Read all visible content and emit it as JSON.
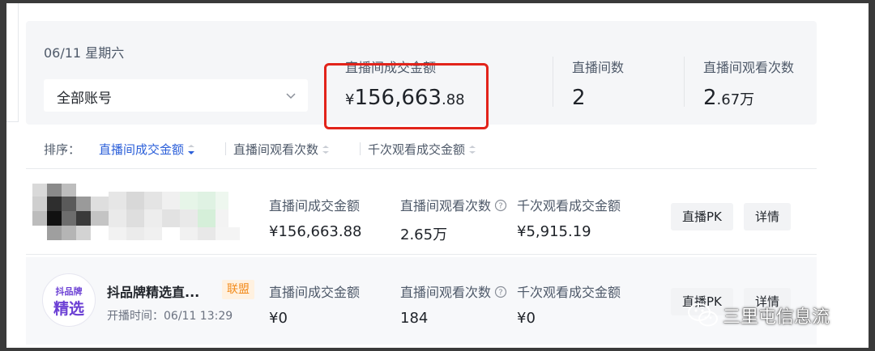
{
  "summary": {
    "date": "06/11 星期六",
    "account_select": "全部账号",
    "metrics": [
      {
        "label": "直播间成交金额",
        "currency": "¥",
        "value_main": "156,663",
        "value_small": ".88"
      },
      {
        "label": "直播间数",
        "value_main": "2",
        "value_small": ""
      },
      {
        "label": "直播间观看次数",
        "value_main": "2",
        "value_small": ".67万"
      }
    ]
  },
  "sort": {
    "label": "排序：",
    "options": [
      {
        "label": "直播间成交金额",
        "active": true
      },
      {
        "label": "直播间观看次数",
        "active": false
      },
      {
        "label": "千次观看成交金额",
        "active": false
      }
    ]
  },
  "rooms": [
    {
      "name": "",
      "columns": [
        {
          "label": "直播间成交金额",
          "value": "¥156,663.88"
        },
        {
          "label": "直播间观看次数",
          "value": "2.65万"
        },
        {
          "label": "千次观看成交金额",
          "value": "¥5,915.19"
        }
      ],
      "buttons": [
        "直播PK",
        "详情"
      ]
    },
    {
      "logo_line1": "抖品牌",
      "logo_line2": "精选",
      "name": "抖品牌精选直...",
      "tag": "联盟",
      "start_time": "开播时间：06/11 13:29",
      "columns": [
        {
          "label": "直播间成交金额",
          "value": "¥0"
        },
        {
          "label": "直播间观看次数",
          "value": "184"
        },
        {
          "label": "千次观看成交金额",
          "value": "¥0"
        }
      ],
      "buttons": [
        "直播PK",
        "详情"
      ]
    }
  ],
  "watermark": "三里屯信息流",
  "colors": {
    "accent": "#2b5fd9",
    "highlight": "#e2231a",
    "tag_text": "#f28c1e",
    "tag_bg": "#fff1e0",
    "logo": "#6b3fd4"
  }
}
